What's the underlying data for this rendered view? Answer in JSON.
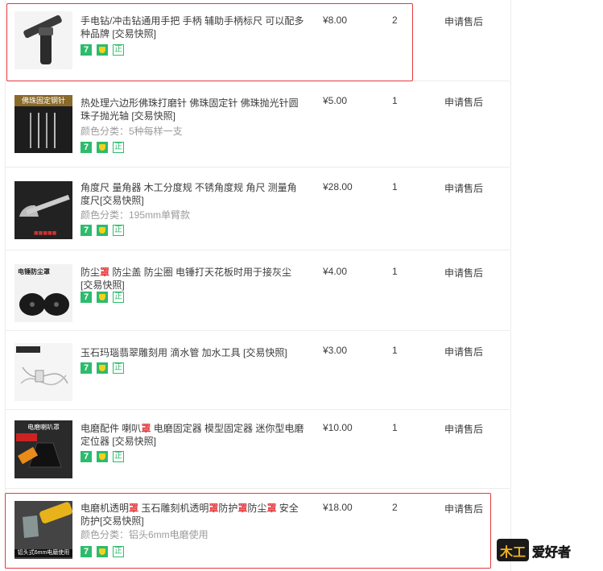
{
  "rows": [
    {
      "title": "手电钻/冲击钻通用手把 手柄 辅助手柄标尺 可以配多种品牌 [交易快照]",
      "title_hl": [],
      "sku": "",
      "price": "¥8.00",
      "qty": "2",
      "action": "申请售后",
      "thumb": "thumb-handle"
    },
    {
      "title": "热处理六边形佛珠打磨针 佛珠固定针 佛珠抛光针圆珠子抛光轴 [交易快照]",
      "sku": "颜色分类：5种每样一支",
      "price": "¥5.00",
      "qty": "1",
      "action": "申请售后",
      "thumb_label": "佛珠固定钢针"
    },
    {
      "title": "角度尺 量角器 木工分度规 不锈角度规 角尺 测量角度尺[交易快照]",
      "sku": "颜色分类：195mm单臂款",
      "price": "¥28.00",
      "qty": "1",
      "action": "申请售后"
    },
    {
      "title_parts": [
        "防尘",
        "罩",
        " 防尘盖 防尘圈 电锤打天花板时用于接灰尘 [交易快照]"
      ],
      "sku": "",
      "price": "¥4.00",
      "qty": "1",
      "action": "申请售后",
      "thumb_label": "电锤防尘罩"
    },
    {
      "title": "玉石玛瑙翡翠雕刻用 滴水管 加水工具 [交易快照]",
      "sku": "",
      "price": "¥3.00",
      "qty": "1",
      "action": "申请售后"
    },
    {
      "title_parts": [
        "电磨配件 喇叭",
        "罩",
        " 电磨固定器 模型固定器 迷你型电磨定位器 [交易快照]"
      ],
      "sku": "",
      "price": "¥10.00",
      "qty": "1",
      "action": "申请售后",
      "thumb_label": "电磨喇叭罩"
    },
    {
      "title_parts": [
        "电磨机透明",
        "罩",
        " 玉石雕刻机透明",
        "罩",
        "防护",
        "罩",
        "防尘",
        "罩",
        " 安全防护[交易快照]"
      ],
      "sku": "颜色分类：铝头6mm电磨使用",
      "price": "¥18.00",
      "qty": "2",
      "action": "申请售后",
      "thumb_label": "铝头式6mm电磨使用"
    }
  ],
  "icons": {
    "seven": "7",
    "zheng": "正"
  },
  "logo": {
    "part1": "木工",
    "part2": "爱好者"
  },
  "colors": {
    "accent": "#2dbb6d",
    "highlight": "#e4393c",
    "border": "#ececec"
  }
}
